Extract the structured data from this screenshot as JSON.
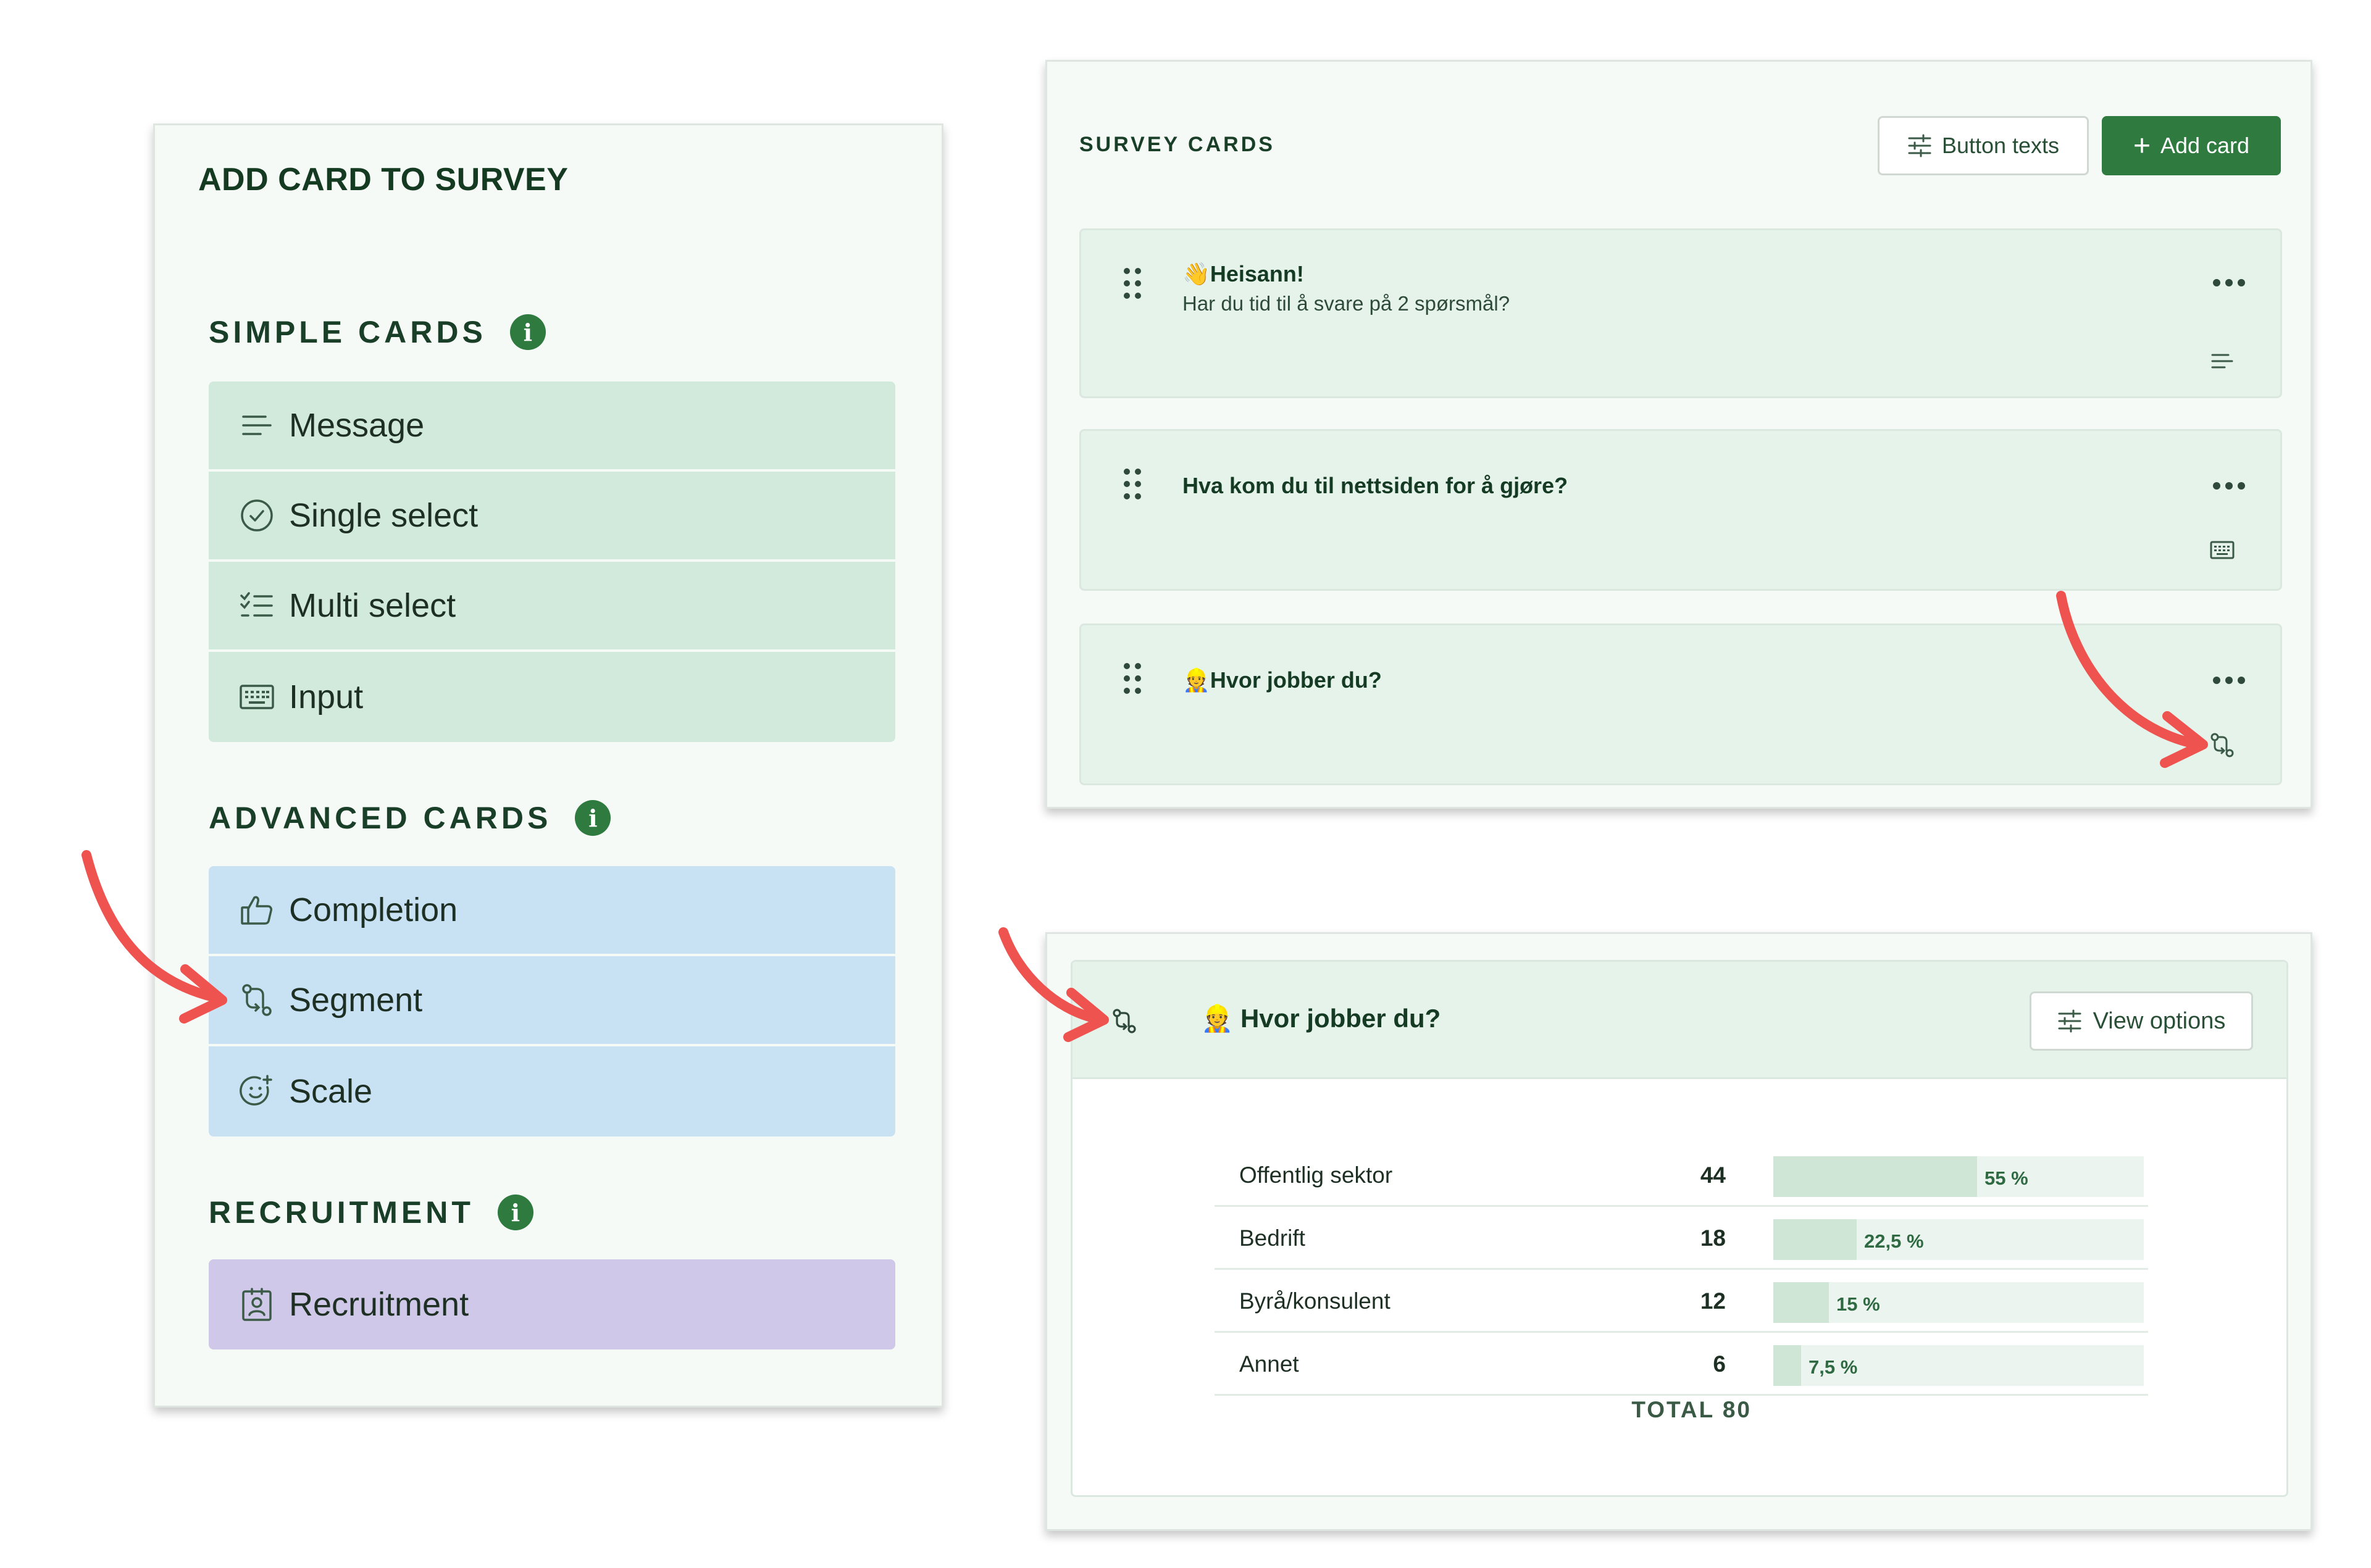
{
  "colors": {
    "brand_green": "#2e7a3f",
    "simple_card_bg": "#d2eadb",
    "advanced_card_bg": "#c8e2f3",
    "recruitment_card_bg": "#cfc8e8",
    "annotation_arrow": "#ef5350"
  },
  "add_card_panel": {
    "title": "ADD CARD TO SURVEY",
    "sections": [
      {
        "heading": "SIMPLE CARDS",
        "info_icon": "i",
        "items": [
          {
            "label": "Message",
            "icon": "lines-icon"
          },
          {
            "label": "Single select",
            "icon": "check-circle-icon"
          },
          {
            "label": "Multi select",
            "icon": "checklist-icon"
          },
          {
            "label": "Input",
            "icon": "keyboard-icon"
          }
        ]
      },
      {
        "heading": "ADVANCED CARDS",
        "info_icon": "i",
        "items": [
          {
            "label": "Completion",
            "icon": "thumbs-up-icon"
          },
          {
            "label": "Segment",
            "icon": "branch-icon"
          },
          {
            "label": "Scale",
            "icon": "smile-plus-icon"
          }
        ]
      },
      {
        "heading": "RECRUITMENT",
        "info_icon": "i",
        "items": [
          {
            "label": "Recruitment",
            "icon": "id-badge-icon"
          }
        ]
      }
    ]
  },
  "survey_cards_panel": {
    "heading": "SURVEY CARDS",
    "button_texts_label": "Button texts",
    "add_card_label": "Add card",
    "add_card_plus": "+",
    "cards": [
      {
        "emoji": "👋",
        "title": "Heisann!",
        "subtitle": "Har du tid til å svare på 2 spørsmål?",
        "type_icon": "lines-icon"
      },
      {
        "emoji": "",
        "title": "Hva kom du til nettsiden for å gjøre?",
        "subtitle": "",
        "type_icon": "keyboard-icon"
      },
      {
        "emoji": "👷",
        "title": "Hvor jobber du?",
        "subtitle": "",
        "type_icon": "branch-icon"
      }
    ]
  },
  "segment_result_panel": {
    "emoji": "👷",
    "title": "Hvor jobber du?",
    "view_options_label": "View options",
    "rows": [
      {
        "label": "Offentlig sektor",
        "count": "44",
        "percent_text": "55 %",
        "fraction": 0.55
      },
      {
        "label": "Bedrift",
        "count": "18",
        "percent_text": "22,5 %",
        "fraction": 0.225
      },
      {
        "label": "Byrå/konsulent",
        "count": "12",
        "percent_text": "15 %",
        "fraction": 0.15
      },
      {
        "label": "Annet",
        "count": "6",
        "percent_text": "7,5 %",
        "fraction": 0.075
      }
    ],
    "total_label": "TOTAL 80"
  }
}
